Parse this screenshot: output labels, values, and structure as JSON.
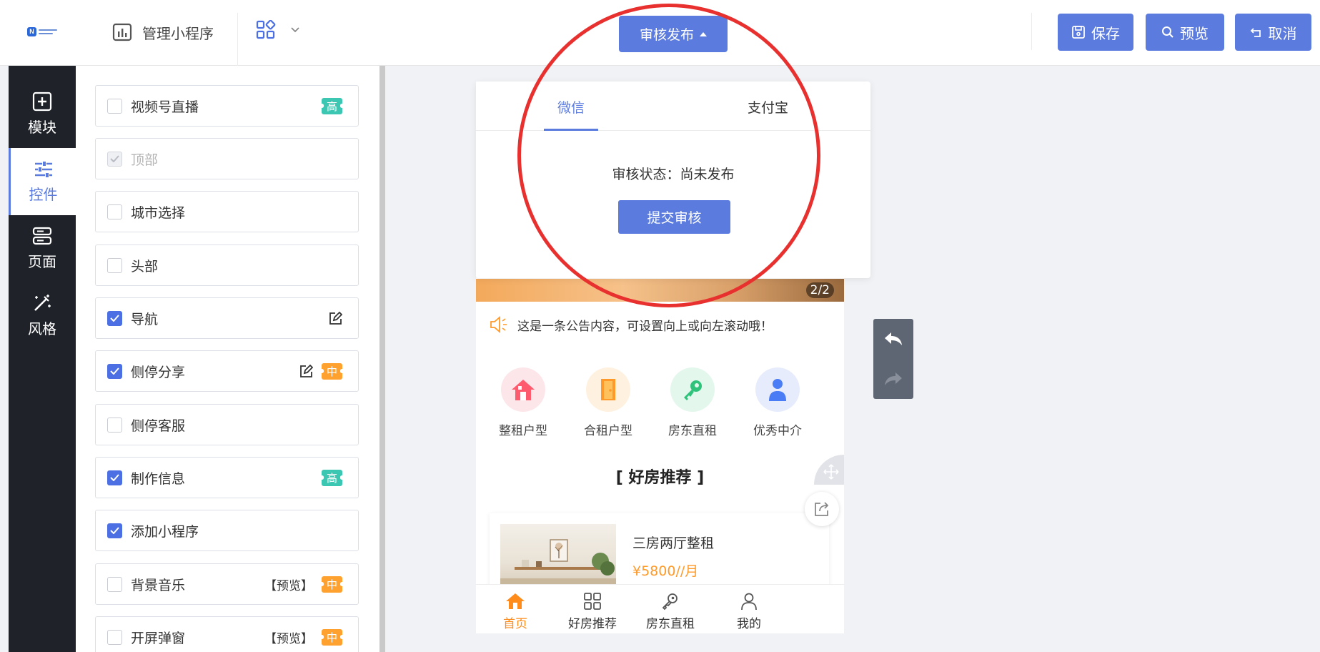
{
  "topbar": {
    "manage_label": "管理小程序",
    "publish_label": "审核发布",
    "save_label": "保存",
    "preview_label": "预览",
    "cancel_label": "取消"
  },
  "leftnav": {
    "items": [
      {
        "label": "模块",
        "icon": "plus-square-icon"
      },
      {
        "label": "控件",
        "icon": "sliders-icon"
      },
      {
        "label": "页面",
        "icon": "server-icon"
      },
      {
        "label": "风格",
        "icon": "magic-wand-icon"
      }
    ],
    "active": "控件"
  },
  "controls": [
    {
      "label": "视频号直播",
      "checked": false,
      "badge": "高"
    },
    {
      "label": "顶部",
      "checked": true,
      "disabled": true
    },
    {
      "label": "城市选择",
      "checked": false
    },
    {
      "label": "头部",
      "checked": false
    },
    {
      "label": "导航",
      "checked": true,
      "edit": true
    },
    {
      "label": "侧停分享",
      "checked": true,
      "edit": true,
      "badge": "中"
    },
    {
      "label": "侧停客服",
      "checked": false
    },
    {
      "label": "制作信息",
      "checked": true,
      "badge": "高"
    },
    {
      "label": "添加小程序",
      "checked": true
    },
    {
      "label": "背景音乐",
      "checked": false,
      "preview": "【预览】",
      "badge": "中"
    },
    {
      "label": "开屏弹窗",
      "checked": false,
      "preview": "【预览】",
      "badge": "中"
    }
  ],
  "popup": {
    "tabs": [
      "微信",
      "支付宝"
    ],
    "active_tab": "微信",
    "status": "审核状态：尚未发布",
    "submit_label": "提交审核"
  },
  "phone": {
    "banner_counter": "2/2",
    "notice": "这是一条公告内容，可设置向上或向左滚动哦！",
    "categories": [
      {
        "label": "整租户型",
        "icon": "house-icon",
        "color": "#ff5b6e",
        "bg": "#fde6ea"
      },
      {
        "label": "合租户型",
        "icon": "door-icon",
        "color": "#ff9a2a",
        "bg": "#fff1df"
      },
      {
        "label": "房东直租",
        "icon": "key-icon",
        "color": "#2fc27a",
        "bg": "#e3f7ec"
      },
      {
        "label": "优秀中介",
        "icon": "person-icon",
        "color": "#4a7cf5",
        "bg": "#e6ecfc"
      }
    ],
    "section_title": "[ 好房推荐 ]",
    "house": {
      "title": "三房两厅整租",
      "price": "¥5800//月"
    },
    "tabbar": [
      {
        "label": "首页",
        "icon": "home-icon"
      },
      {
        "label": "好房推荐",
        "icon": "grid-icon"
      },
      {
        "label": "房东直租",
        "icon": "key-icon"
      },
      {
        "label": "我的",
        "icon": "user-icon"
      }
    ],
    "active_tab": "首页"
  },
  "colors": {
    "accent": "#5b7bde",
    "checkbox": "#4c6fe3",
    "badge_high": "#3cc7b2",
    "badge_mid": "#ffa12e",
    "price": "#ff9a2a",
    "annotation": "#e8302f",
    "nav_bg": "#1f2329"
  }
}
